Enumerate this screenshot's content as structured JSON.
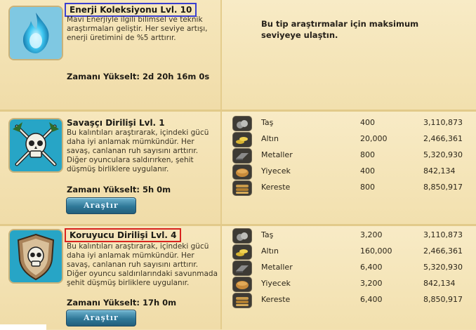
{
  "research_items": [
    {
      "title": "Enerji Koleksiyonu Lvl. 10",
      "description": "Mavi Enerjiyle ilgili bilimsel ve teknik araştırmaları geliştir. Her seviye artışı, enerji üretimini de %5 arttırır.",
      "upgrade_time": "Zamanı Yükselt: 2d 20h 16m 0s",
      "max_message": "Bu tip araştırmalar için maksimum seviyeye ulaştın.",
      "icon": "blue-flame-icon"
    },
    {
      "title": "Savaşçı Dirilişi Lvl. 1",
      "description": "Bu kalıntıları araştırarak, içindeki gücü daha iyi anlamak mümkündür. Her savaş, canlanan ruh sayısını arttırır. Diğer oyunculara saldırırken, şehit düşmüş birliklere uygulanır.",
      "upgrade_time": "Zamanı Yükselt: 5h 0m",
      "button_label": "Araştır",
      "icon": "skull-crossed-swords-icon",
      "resources": [
        {
          "name": "Taş",
          "required": "400",
          "owned": "3,110,873",
          "icon": "stone-icon"
        },
        {
          "name": "Altın",
          "required": "20,000",
          "owned": "2,466,361",
          "icon": "gold-icon"
        },
        {
          "name": "Metaller",
          "required": "800",
          "owned": "5,320,930",
          "icon": "metal-icon"
        },
        {
          "name": "Yiyecek",
          "required": "400",
          "owned": "842,134",
          "icon": "bread-icon"
        },
        {
          "name": "Kereste",
          "required": "800",
          "owned": "8,850,917",
          "icon": "lumber-icon"
        }
      ]
    },
    {
      "title": "Koruyucu Dirilişi Lvl. 4",
      "description": "Bu kalıntıları araştırarak, içindeki gücü daha iyi anlamak mümkündür. Her savaş, canlanan ruh sayısını arttırır. Diğer oyuncu saldırılarındaki savunmada şehit düşmüş birliklere uygulanır.",
      "upgrade_time": "Zamanı Yükselt: 17h 0m",
      "button_label": "Araştır",
      "icon": "skull-shield-icon",
      "resources": [
        {
          "name": "Taş",
          "required": "3,200",
          "owned": "3,110,873",
          "icon": "stone-icon"
        },
        {
          "name": "Altın",
          "required": "160,000",
          "owned": "2,466,361",
          "icon": "gold-icon"
        },
        {
          "name": "Metaller",
          "required": "6,400",
          "owned": "5,320,930",
          "icon": "metal-icon"
        },
        {
          "name": "Yiyecek",
          "required": "3,200",
          "owned": "842,134",
          "icon": "bread-icon"
        },
        {
          "name": "Kereste",
          "required": "6,400",
          "owned": "8,850,917",
          "icon": "lumber-icon"
        }
      ]
    }
  ],
  "colors": {
    "panel_bg": "#f3e2b3",
    "button_blue": "#2f7898",
    "highlight_blue": "#3a3fd0",
    "highlight_red": "#d8231e"
  }
}
